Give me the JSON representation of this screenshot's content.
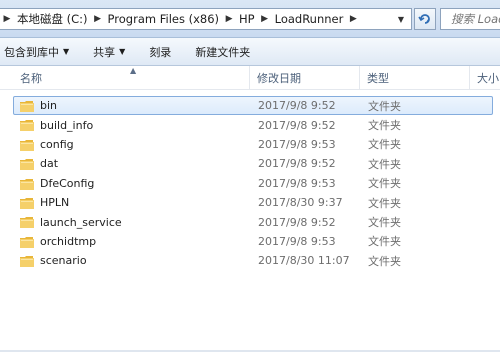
{
  "address": {
    "crumbs": [
      "本地磁盘 (C:)",
      "Program Files (x86)",
      "HP",
      "LoadRunner"
    ]
  },
  "search": {
    "placeholder": "搜索 Load"
  },
  "toolbar": {
    "include_library": "包含到库中",
    "share": "共享",
    "burn": "刻录",
    "new_folder": "新建文件夹"
  },
  "columns": {
    "name": "名称",
    "date": "修改日期",
    "type": "类型",
    "size": "大小"
  },
  "files": [
    {
      "name": "bin",
      "date": "2017/9/8 9:52",
      "type": "文件夹"
    },
    {
      "name": "build_info",
      "date": "2017/9/8 9:52",
      "type": "文件夹"
    },
    {
      "name": "config",
      "date": "2017/9/8 9:53",
      "type": "文件夹"
    },
    {
      "name": "dat",
      "date": "2017/9/8 9:52",
      "type": "文件夹"
    },
    {
      "name": "DfeConfig",
      "date": "2017/9/8 9:53",
      "type": "文件夹"
    },
    {
      "name": "HPLN",
      "date": "2017/8/30 9:37",
      "type": "文件夹"
    },
    {
      "name": "launch_service",
      "date": "2017/9/8 9:52",
      "type": "文件夹"
    },
    {
      "name": "orchidtmp",
      "date": "2017/9/8 9:53",
      "type": "文件夹"
    },
    {
      "name": "scenario",
      "date": "2017/8/30 11:07",
      "type": "文件夹"
    }
  ],
  "colors": {
    "selection_border": "#84acdd",
    "folder_yellow": "#f2c94c"
  }
}
